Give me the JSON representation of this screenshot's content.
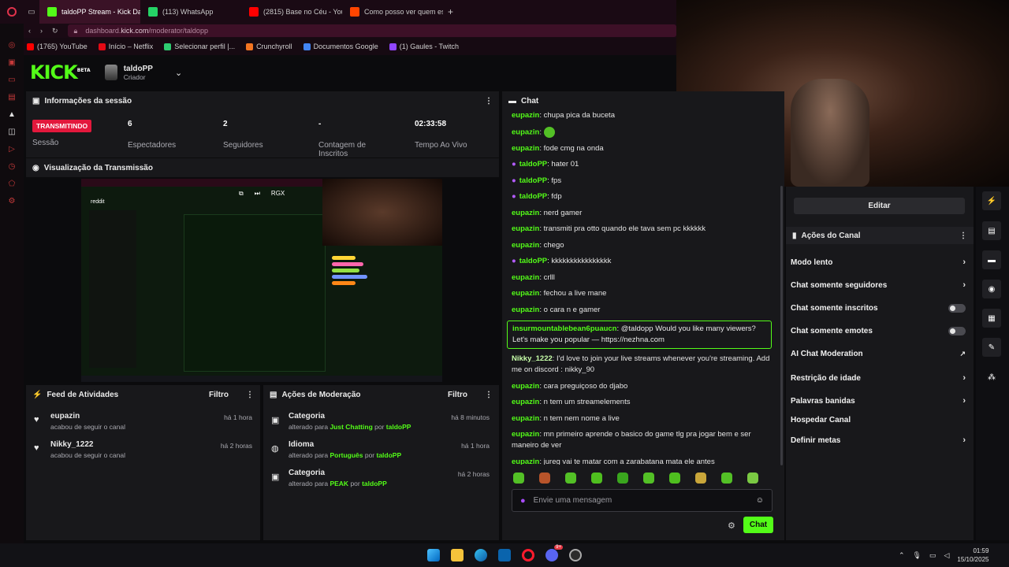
{
  "browser": {
    "tabs": [
      {
        "label": "taldoPP Stream - Kick Da",
        "color": "#53fc18",
        "active": true
      },
      {
        "label": "(113) WhatsApp",
        "color": "#25d366",
        "active": false
      },
      {
        "label": "(2815) Base no Céu - You",
        "color": "#ff0000",
        "active": false
      },
      {
        "label": "Como posso ver quem es",
        "color": "#ff4500",
        "active": false
      }
    ],
    "new_tab_label": "+",
    "url_host": "dashboard.",
    "url_domain": "kick.com",
    "url_path": "/moderator/taldopp",
    "bookmarks": [
      "(1765) YouTube",
      "Início – Netflix",
      "Selecionar perfil |...",
      "Crunchyroll",
      "Documentos Google",
      "(1) Gaules - Twitch"
    ],
    "bookmark_colors": [
      "#ff0000",
      "#e50914",
      "#2ecc71",
      "#f47521",
      "#4285f4",
      "#9146ff"
    ]
  },
  "header": {
    "logo": "KICK",
    "logo_sup": "BETA",
    "channel_name": "taldoPP",
    "channel_role": "Criador"
  },
  "session": {
    "title": "Informações da sessão",
    "status_badge": "TRANSMITINDO",
    "status_label": "Sessão",
    "stats": [
      {
        "value": "6",
        "label": "Espectadores"
      },
      {
        "value": "2",
        "label": "Seguidores"
      },
      {
        "value": "-",
        "label": "Contagem de Inscritos"
      },
      {
        "value": "02:33:58",
        "label": "Tempo Ao Vivo"
      }
    ]
  },
  "preview": {
    "title": "Visualização da Transmissão",
    "overlay_text": "RGX",
    "inner_brand": "reddit"
  },
  "feed": {
    "title": "Feed de Atividades",
    "filter": "Filtro",
    "items": [
      {
        "user": "eupazin",
        "time": "há 1 hora",
        "desc": "acabou de seguir o canal"
      },
      {
        "user": "Nikky_1222",
        "time": "há 2 horas",
        "desc": "acabou de seguir o canal"
      }
    ]
  },
  "modactions": {
    "title": "Ações de Moderação",
    "filter": "Filtro",
    "items": [
      {
        "title": "Categoria",
        "time": "há 8 minutos",
        "pre": "alterado para ",
        "value": "Just Chatting",
        "mid": " por ",
        "by": "taldoPP"
      },
      {
        "title": "Idioma",
        "time": "há 1 hora",
        "pre": "alterado para ",
        "value": "Português",
        "mid": " por ",
        "by": "taldoPP"
      },
      {
        "title": "Categoria",
        "time": "há 2 horas",
        "pre": "alterado para ",
        "value": "PEAK",
        "mid": " por ",
        "by": "taldoPP"
      }
    ]
  },
  "chat": {
    "title": "Chat",
    "messages": [
      {
        "user": "eupazin",
        "text": ": chupa pica da buceta",
        "mod": false
      },
      {
        "user": "eupazin",
        "text": ": ",
        "mod": false,
        "emote": true
      },
      {
        "user": "eupazin",
        "text": ": fode cmg na onda",
        "mod": false
      },
      {
        "user": "taldoPP",
        "text": ": hater 01",
        "mod": true
      },
      {
        "user": "taldoPP",
        "text": ": fps",
        "mod": true
      },
      {
        "user": "taldoPP",
        "text": ": fdp",
        "mod": true
      },
      {
        "user": "eupazin",
        "text": ": nerd gamer",
        "mod": false
      },
      {
        "user": "eupazin",
        "text": ": transmiti pra otto quando ele tava sem pc kkkkkk",
        "mod": false
      },
      {
        "user": "eupazin",
        "text": ": chego",
        "mod": false
      },
      {
        "user": "taldoPP",
        "text": ": kkkkkkkkkkkkkkkk",
        "mod": true
      },
      {
        "user": "eupazin",
        "text": ": crlll",
        "mod": false
      },
      {
        "user": "eupazin",
        "text": ": fechou a live mane",
        "mod": false
      },
      {
        "user": "eupazin",
        "text": ": o cara n e gamer",
        "mod": false
      }
    ],
    "highlight": {
      "user": "insurmountablebean6puaucn",
      "text": ": @taldopp Would you like many viewers? Let's make you popular — https://nezhna.com"
    },
    "messages2": [
      {
        "user": "Nikky_1222",
        "text": ": I'd love to join your live streams whenever you're streaming. Add me on discord : nikky_90"
      },
      {
        "user": "eupazin",
        "text": ": cara preguiçoso do djabo"
      },
      {
        "user": "eupazin",
        "text": ": n tem um streamelements"
      },
      {
        "user": "eupazin",
        "text": ": n tem nem nome a live"
      },
      {
        "user": "eupazin",
        "text": ": mn primeiro aprende o basico do game tlg pra jogar bem e ser maneiro de ver"
      },
      {
        "user": "eupazin",
        "text": ": jureg vai te matar com a zarabatana mata ele antes"
      }
    ],
    "input_placeholder": "Envie uma mensagem",
    "send_label": "Chat"
  },
  "channel_actions": {
    "edit_label": "Editar",
    "title": "Ações do Canal",
    "items": [
      {
        "label": "Modo lento",
        "kind": "chevron"
      },
      {
        "label": "Chat somente seguidores",
        "kind": "chevron"
      },
      {
        "label": "Chat somente inscritos",
        "kind": "toggle",
        "on": false
      },
      {
        "label": "Chat somente emotes",
        "kind": "toggle",
        "on": false
      },
      {
        "label": "AI Chat Moderation",
        "kind": "external"
      },
      {
        "label": "Restrição de idade",
        "kind": "chevron"
      },
      {
        "label": "Palavras banidas",
        "kind": "chevron"
      },
      {
        "label": "Hospedar Canal",
        "kind": "none"
      },
      {
        "label": "Definir metas",
        "kind": "chevron"
      }
    ]
  },
  "taskbar": {
    "time": "01:59",
    "date": "15/10/2025",
    "discord_badge": "9+"
  },
  "colors": {
    "accent": "#53fc18",
    "live": "#e3183c",
    "panel": "#18181b"
  }
}
